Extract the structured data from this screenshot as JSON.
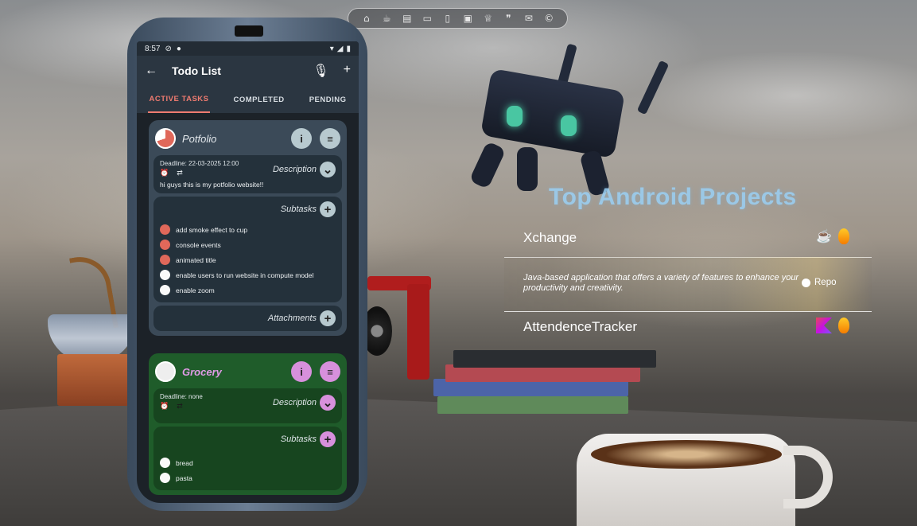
{
  "dock": {
    "icons": [
      "home-icon",
      "coffee-icon",
      "document-icon",
      "laptop-icon",
      "phone-icon",
      "browser-icon",
      "trophy-icon",
      "quote-icon",
      "mail-icon",
      "copyright-icon"
    ]
  },
  "phone": {
    "status": {
      "time": "8:57"
    },
    "appbar": {
      "title": "Todo List"
    },
    "tabs": [
      "ACTIVE TASKS",
      "COMPLETED",
      "PENDING"
    ],
    "cards": [
      {
        "title": "Potfolio",
        "info_label": "i",
        "menu_label": "≡",
        "deadline": "Deadline: 22-03-2025 12:00",
        "description_label": "Description",
        "description": "hi guys this is my potfolio website!!",
        "subtasks_label": "Subtasks",
        "subtasks": [
          {
            "text": "add smoke effect to cup",
            "done": true
          },
          {
            "text": "console events",
            "done": true
          },
          {
            "text": "animated title",
            "done": true
          },
          {
            "text": "enable users to run website in compute model",
            "done": false
          },
          {
            "text": "enable zoom",
            "done": false
          }
        ],
        "attachments_label": "Attachments"
      },
      {
        "title": "Grocery",
        "info_label": "i",
        "menu_label": "≡",
        "deadline": "Deadline: none",
        "description_label": "Description",
        "subtasks_label": "Subtasks",
        "subtasks": [
          {
            "text": "bread",
            "done": false
          },
          {
            "text": "pasta",
            "done": false
          }
        ]
      }
    ]
  },
  "projects": {
    "title": "Top Android Projects",
    "items": [
      {
        "name": "Xchange",
        "icons": [
          "java-icon",
          "firebase-icon"
        ]
      },
      {
        "description": "Java-based application that offers a variety of features to enhance your productivity and creativity.",
        "repo_label": "Repo"
      },
      {
        "name": "AttendenceTracker",
        "icons": [
          "kotlin-icon",
          "firebase-icon"
        ]
      }
    ]
  },
  "colors": {
    "accent": "#ef7b70",
    "card_blue": "#3b4a58",
    "card_green": "#1f5c2a",
    "title_blue": "#9ad0f5"
  }
}
